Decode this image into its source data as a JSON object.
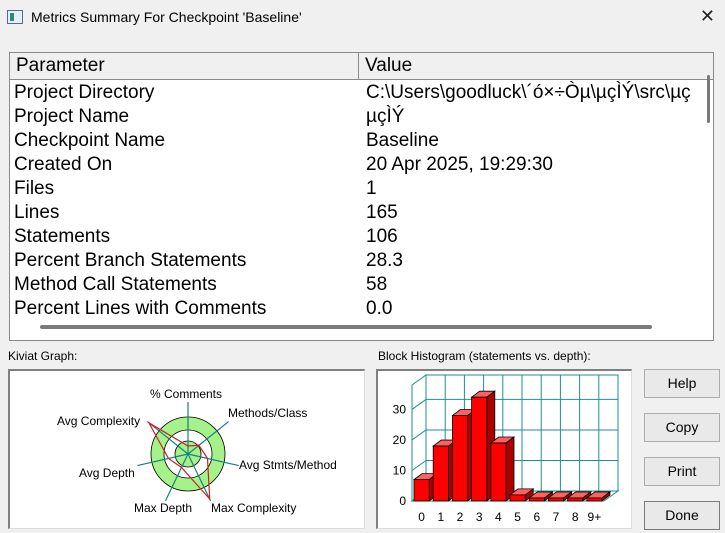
{
  "window": {
    "title": "Metrics Summary For Checkpoint 'Baseline'"
  },
  "table": {
    "headers": [
      "Parameter",
      "Value"
    ],
    "rows": [
      {
        "param": "Project Directory",
        "value": "C:\\Users\\goodluck\\´ó×÷Òµ\\µçÌÝ\\src\\µç"
      },
      {
        "param": "Project Name",
        "value": "µçÌÝ"
      },
      {
        "param": "Checkpoint Name",
        "value": "Baseline"
      },
      {
        "param": "Created On",
        "value": "20 Apr 2025, 19:29:30"
      },
      {
        "param": "Files",
        "value": "1"
      },
      {
        "param": "Lines",
        "value": "165"
      },
      {
        "param": "Statements",
        "value": "106"
      },
      {
        "param": "Percent Branch Statements",
        "value": "28.3"
      },
      {
        "param": "Method Call Statements",
        "value": "58"
      },
      {
        "param": "Percent Lines with Comments",
        "value": "0.0"
      }
    ]
  },
  "kiviat": {
    "label": "Kiviat Graph:",
    "axes": [
      "% Comments",
      "Methods/Class",
      "Avg Stmts/Method",
      "Max Complexity",
      "Max Depth",
      "Avg Depth",
      "Avg Complexity"
    ],
    "colors": {
      "band": "#a6f28a",
      "line": "#cc2222",
      "spoke": "#1a7f7f"
    }
  },
  "chart_data": {
    "type": "bar",
    "title": "Block Histogram (statements vs. depth):",
    "categories": [
      "0",
      "1",
      "2",
      "3",
      "4",
      "5",
      "6",
      "7",
      "8",
      "9+"
    ],
    "values": [
      7,
      18,
      28,
      34,
      19,
      2,
      1,
      1,
      1,
      1
    ],
    "yticks": [
      0,
      10,
      20,
      30
    ],
    "ylim": [
      0,
      38
    ],
    "colors": {
      "bar": "#ff0000",
      "grid": "#1f8f8f"
    }
  },
  "buttons": {
    "help": "Help",
    "copy": "Copy",
    "print": "Print",
    "done": "Done"
  }
}
